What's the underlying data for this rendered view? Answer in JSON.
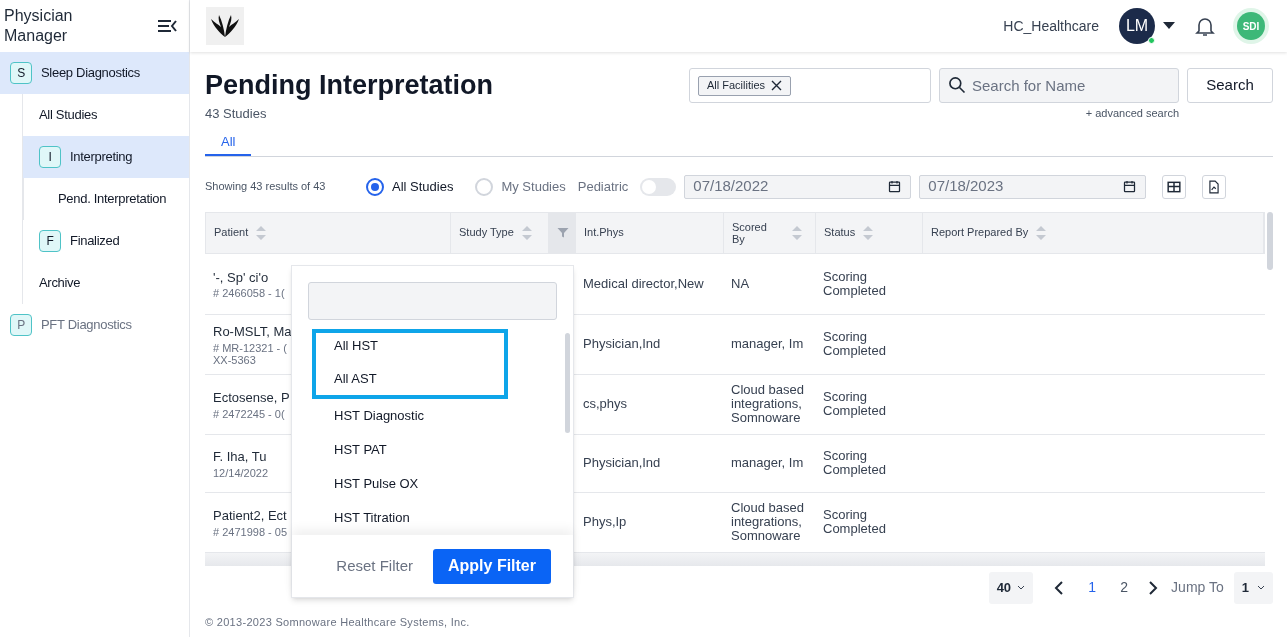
{
  "app": {
    "title": "Physician Manager"
  },
  "header": {
    "organization": "HC_Healthcare",
    "user_initials": "LM",
    "brand_badge": "SDI"
  },
  "sidebar": {
    "items": [
      {
        "badge": "S",
        "label": "Sleep Diagnostics",
        "selected": true,
        "children": [
          {
            "label": "All Studies",
            "selected": false
          },
          {
            "badge": "I",
            "label": "Interpreting",
            "selected": true,
            "children": [
              {
                "label": "Pend. Interpretation",
                "selected": false
              }
            ]
          },
          {
            "badge": "F",
            "label": "Finalized",
            "selected": false
          },
          {
            "label": "Archive",
            "selected": false
          }
        ]
      },
      {
        "badge": "P",
        "label": "PFT Diagnostics",
        "selected": false
      }
    ]
  },
  "page": {
    "title": "Pending Interpretation",
    "count": "43 Studies"
  },
  "facility_filter": {
    "chip": "All Facilities"
  },
  "search": {
    "placeholder": "Search for Name",
    "button": "Search",
    "advanced": "+ advanced search"
  },
  "tabs": [
    {
      "label": "All",
      "selected": true
    }
  ],
  "filters": {
    "showing": "Showing 43 results of 43",
    "scope": [
      {
        "label": "All Studies",
        "selected": true
      },
      {
        "label": "My Studies",
        "selected": false
      }
    ],
    "pediatric": {
      "label": "Pediatric",
      "on": false
    },
    "date_from": "07/18/2022",
    "date_to": "07/18/2023"
  },
  "table": {
    "columns": [
      "Patient",
      "Study Type",
      "Int.Phys",
      "Scored By",
      "Status",
      "Report Prepared By"
    ],
    "rows": [
      {
        "patient": "'-, Sp' ci'o",
        "detail": [
          "# 2466058 - 1("
        ],
        "int_phys": "Medical director,New",
        "scored_by": "NA",
        "status": "Scoring Completed"
      },
      {
        "patient": "Ro-MSLT, Ma",
        "detail": [
          "# MR-12321 - (",
          "XX-5363"
        ],
        "int_phys": "Physician,Ind",
        "scored_by": "manager, Im",
        "status": "Scoring Completed"
      },
      {
        "patient": "Ectosense, P",
        "detail": [
          "# 2472245 - 0("
        ],
        "int_phys": "cs,phys",
        "scored_by": "Cloud based integrations, Somnoware",
        "status": "Scoring Completed"
      },
      {
        "patient": "F. Iha, Tu",
        "detail": [
          "12/14/2022"
        ],
        "int_phys": "Physician,Ind",
        "scored_by": "manager, Im",
        "status": "Scoring Completed"
      },
      {
        "patient": "Patient2, Ect",
        "detail": [
          "# 2471998 - 05"
        ],
        "int_phys": "Phys,Ip",
        "scored_by": "Cloud based integrations, Somnoware",
        "status": "Scoring Completed"
      }
    ]
  },
  "filter_dropdown": {
    "options": [
      {
        "label": "All HST",
        "highlighted": true
      },
      {
        "label": "All AST",
        "highlighted": true
      },
      {
        "label": "HST Diagnostic",
        "highlighted": false
      },
      {
        "label": "HST PAT",
        "highlighted": false
      },
      {
        "label": "HST Pulse OX",
        "highlighted": false
      },
      {
        "label": "HST Titration",
        "highlighted": false
      }
    ],
    "reset": "Reset Filter",
    "apply": "Apply Filter"
  },
  "pagination": {
    "page_size": "40",
    "pages": [
      {
        "label": "1",
        "selected": true
      },
      {
        "label": "2",
        "selected": false
      }
    ],
    "jump_label": "Jump To",
    "jump_value": "1"
  },
  "footer": "© 2013-2023 Somnoware Healthcare Systems, Inc."
}
